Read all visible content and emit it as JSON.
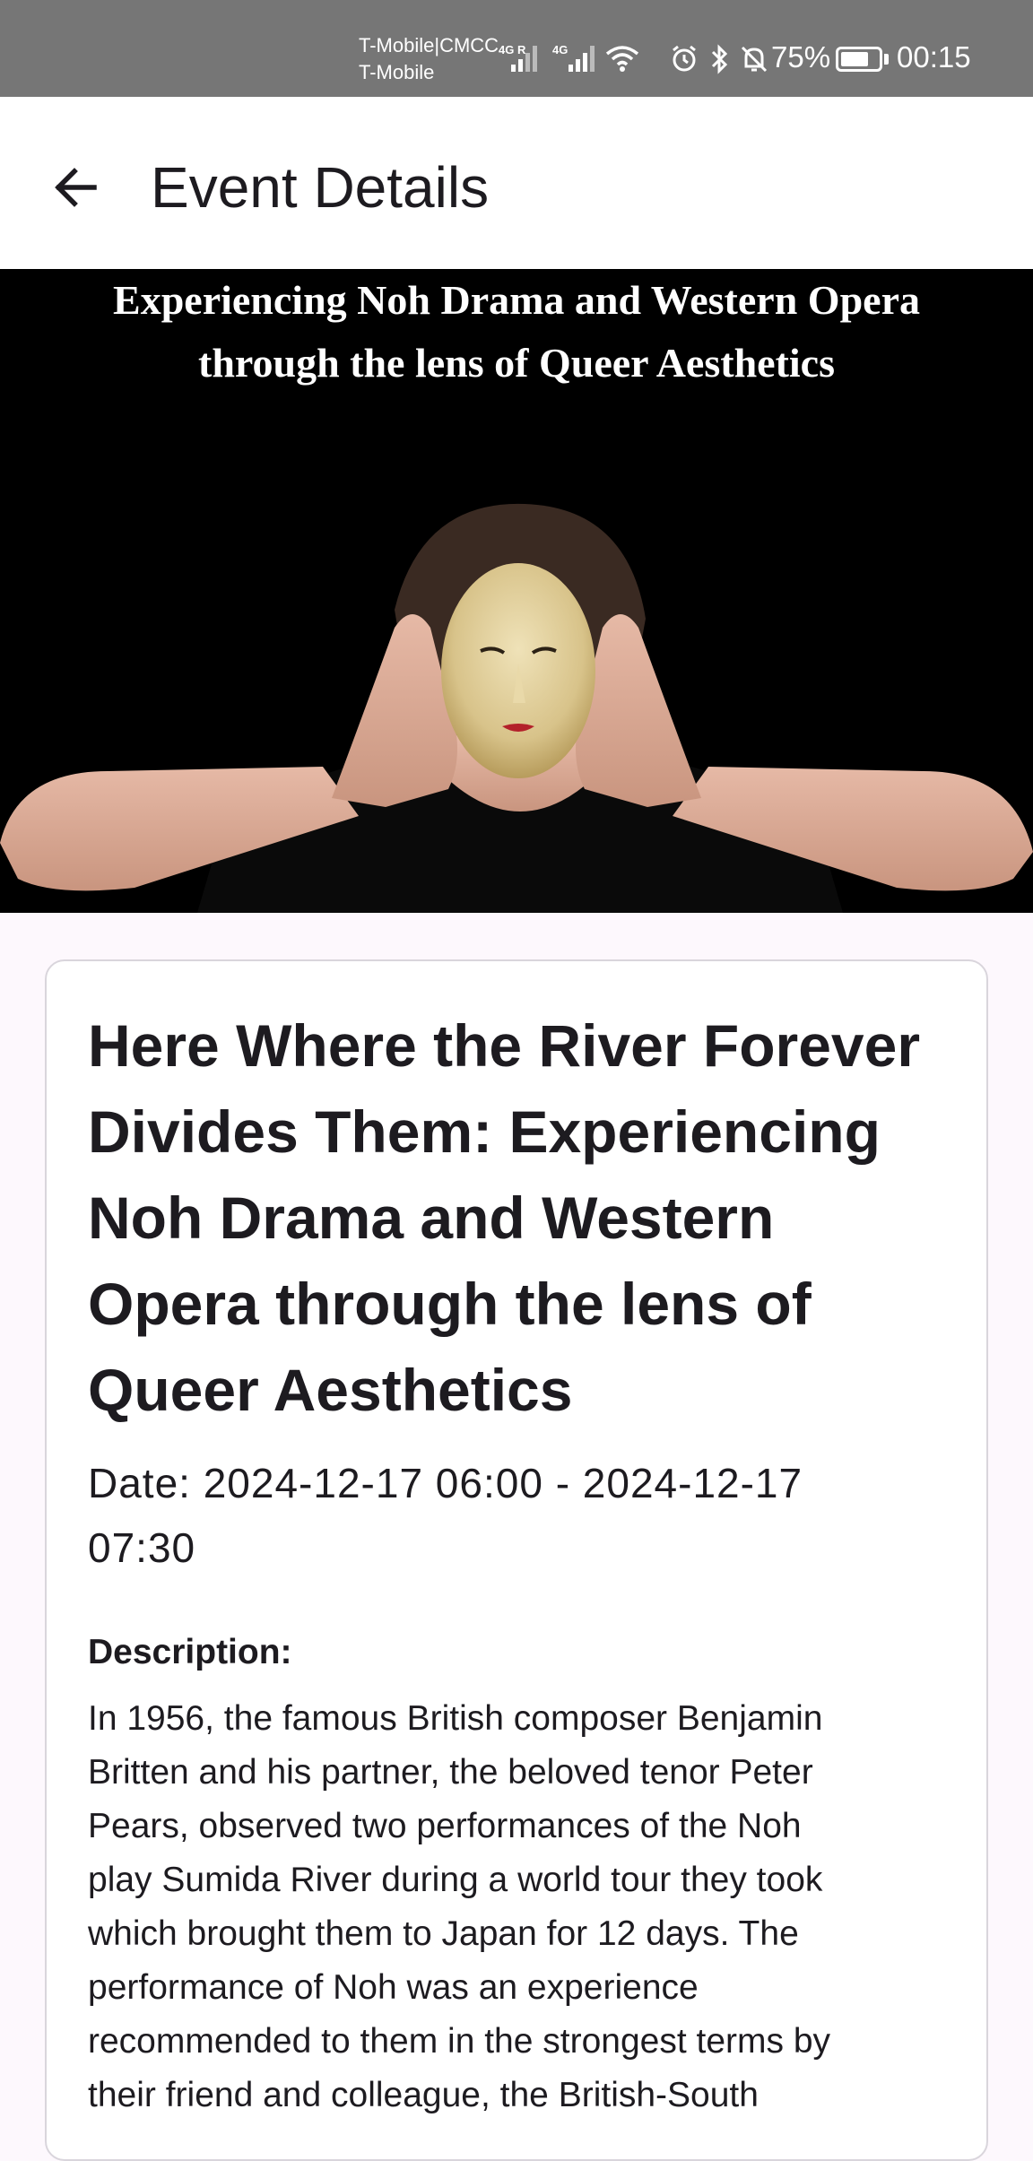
{
  "status_bar": {
    "carrier_line1": "T-Mobile|CMCC",
    "carrier_line2": "T-Mobile",
    "sim1_label": "4G R",
    "sim2_label": "4G",
    "battery_percent": "75%",
    "battery_level": 0.75,
    "time": "00:15",
    "background_color": "#767676"
  },
  "app_bar": {
    "back_icon": "arrow-left-icon",
    "title": "Event Details"
  },
  "banner": {
    "title_line1": "Experiencing Noh Drama and Western Opera",
    "title_line2": "through the lens of Queer Aesthetics"
  },
  "event": {
    "title_lines": [
      "Here Where the River Forever",
      "Divides Them: Experiencing",
      "Noh Drama and Western",
      "Opera through the lens of",
      "Queer Aesthetics"
    ],
    "date_lines": [
      "Date: 2024-12-17 06:00 - 2024-12-17",
      "07:30"
    ],
    "description_label": "Description:",
    "description_lines": [
      "In 1956, the famous British composer Benjamin",
      "Britten and his partner, the beloved tenor Peter",
      "Pears, observed two performances of the Noh",
      "play Sumida River during a world tour they took",
      "which brought them to Japan for 12 days. The",
      "performance of Noh was an experience",
      "recommended to them in the strongest terms by",
      "their friend and colleague, the British-South"
    ]
  }
}
